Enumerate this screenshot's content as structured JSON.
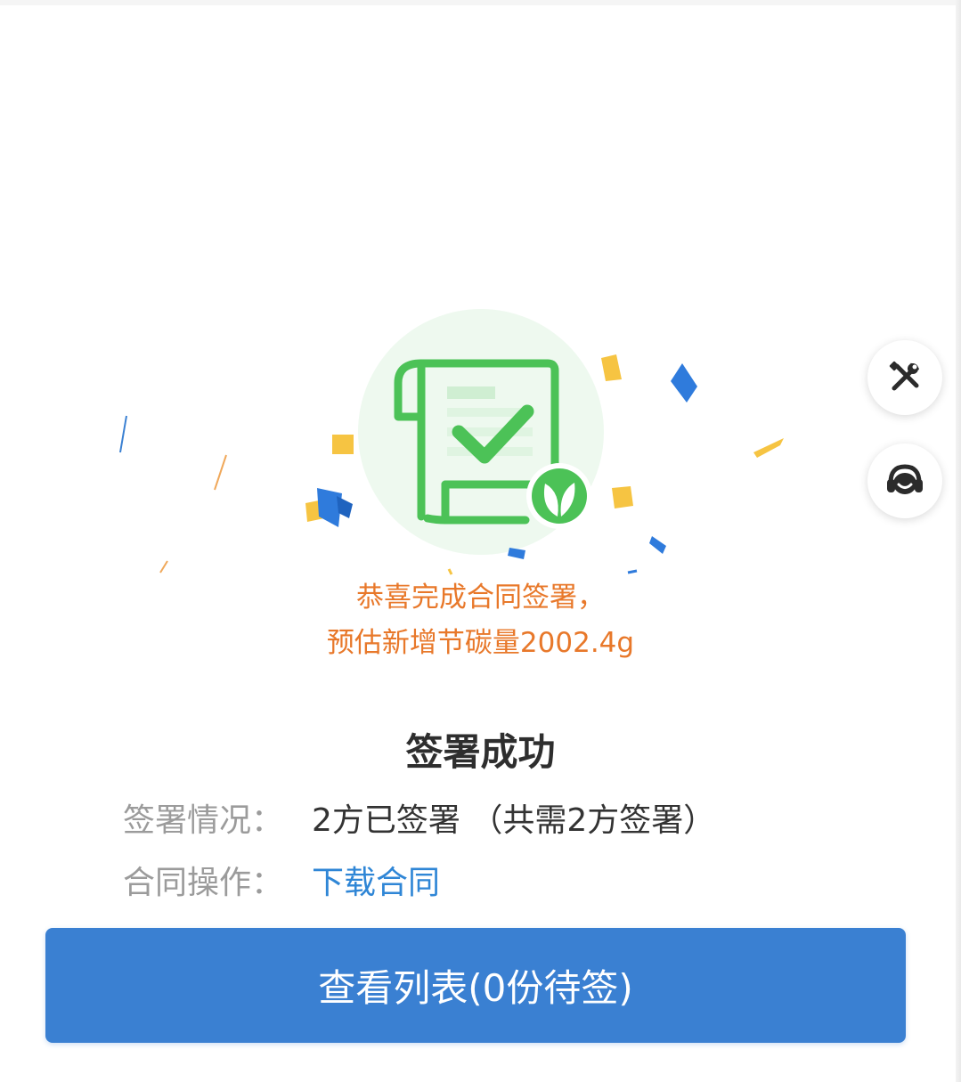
{
  "congrats": {
    "line1": "恭喜完成合同签署，",
    "line2": "预估新增节碳量2002.4g"
  },
  "status": {
    "title": "签署成功"
  },
  "info": {
    "sign_label": "签署情况：",
    "sign_value": "2方已签署 （共需2方签署）",
    "action_label": "合同操作：",
    "action_link": "下载合同"
  },
  "button": {
    "label": "查看列表(0份待签)"
  },
  "side_buttons": {
    "tools_icon": "tools-icon",
    "service_icon": "customer-service-icon"
  },
  "colors": {
    "accent_blue": "#3a80d2",
    "link_blue": "#2f86d6",
    "congrats_orange": "#e8782a",
    "success_green": "#4cc257"
  }
}
